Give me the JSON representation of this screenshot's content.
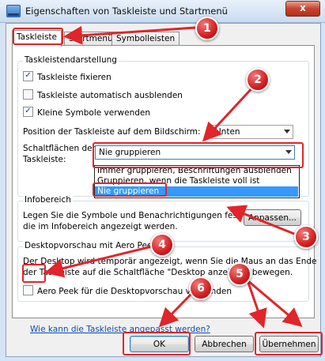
{
  "window": {
    "title": "Eigenschaften von Taskleiste und Startmenü",
    "close_label": "x"
  },
  "tabs": [
    {
      "label": "Taskleiste",
      "active": true
    },
    {
      "label": "Startmenü",
      "active": false
    },
    {
      "label": "Symbolleisten",
      "active": false
    }
  ],
  "taskbar_group": {
    "title": "Taskleistendarstellung",
    "checkboxes": [
      {
        "label": "Taskleiste fixieren",
        "checked": true
      },
      {
        "label": "Taskleiste automatisch ausblenden",
        "checked": false
      },
      {
        "label": "Kleine Symbole verwenden",
        "checked": true
      }
    ],
    "position_label": "Position der Taskleiste auf dem Bildschirm:",
    "position_value": "Unten",
    "buttons_label_line1": "Schaltflächen der",
    "buttons_label_line2": "Taskleiste:",
    "buttons_value": "Nie gruppieren",
    "buttons_options": [
      "Immer gruppieren, Beschriftungen ausblenden",
      "Gruppieren, wenn die Taskleiste voll ist",
      "Nie gruppieren"
    ]
  },
  "notification_group": {
    "title": "Infobereich",
    "text_line1": "Legen Sie die Symbole und Benachrichtigungen fest,",
    "text_line2": "die im Infobereich angezeigt werden.",
    "customize_button": "Anpassen..."
  },
  "aero_group": {
    "title": "Desktopvorschau mit Aero Peek",
    "text_line1": "Der Desktop wird temporär angezeigt, wenn Sie die Maus an das Ende",
    "text_line2": "der Taskleiste auf die Schaltfläche \"Desktop anzeigen\" bewegen.",
    "checkbox_label": "Aero Peek für die Desktopvorschau verwenden",
    "checked": false
  },
  "help_link": "Wie kann die Taskleiste angepasst werden?",
  "footer_buttons": {
    "ok": "OK",
    "cancel": "Abbrechen",
    "apply": "Übernehmen"
  },
  "annotations": {
    "color": "#e0252b",
    "badges": [
      "1",
      "2",
      "3",
      "4",
      "5",
      "6"
    ]
  }
}
